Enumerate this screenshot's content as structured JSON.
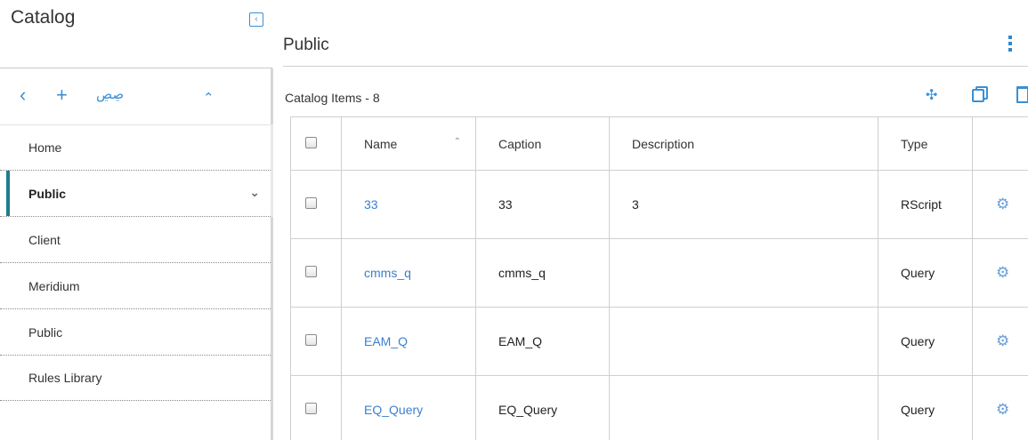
{
  "sidebar": {
    "title": "Catalog",
    "toolbar": {
      "back": "‹",
      "add": "+",
      "search": "ꙭ",
      "up": "^"
    },
    "items": [
      {
        "label": "Home"
      },
      {
        "label": "Public",
        "expanded_icon": "chevron-down"
      },
      {
        "label": "Client"
      },
      {
        "label": "Meridium"
      },
      {
        "label": "Public"
      },
      {
        "label": "Rules Library"
      }
    ]
  },
  "main": {
    "title": "Public",
    "items_count": "Catalog Items - 8",
    "table": {
      "headers": [
        "Name",
        "Caption",
        "Description",
        "Type"
      ],
      "rows": [
        {
          "name": "33",
          "caption": "33",
          "description": "3",
          "type": "RScript"
        },
        {
          "name": "cmms_q",
          "caption": "cmms_q",
          "description": "",
          "type": "Query"
        },
        {
          "name": "EAM_Q",
          "caption": "EAM_Q",
          "description": "",
          "type": "Query"
        },
        {
          "name": "EQ_Query",
          "caption": "EQ_Query",
          "description": "",
          "type": "Query"
        }
      ]
    }
  },
  "colors": {
    "accent": "#3b8fd4",
    "active_bar": "#1f7d8c",
    "link": "#3b7fd0"
  },
  "icons": [
    "collapse-panel-icon",
    "back-icon",
    "add-icon",
    "binoculars-icon",
    "chevron-up-icon",
    "chevron-down-icon",
    "more-vertical-icon",
    "move-icon",
    "copy-icon",
    "delete-icon",
    "sort-ascending-icon",
    "gear-icon"
  ]
}
